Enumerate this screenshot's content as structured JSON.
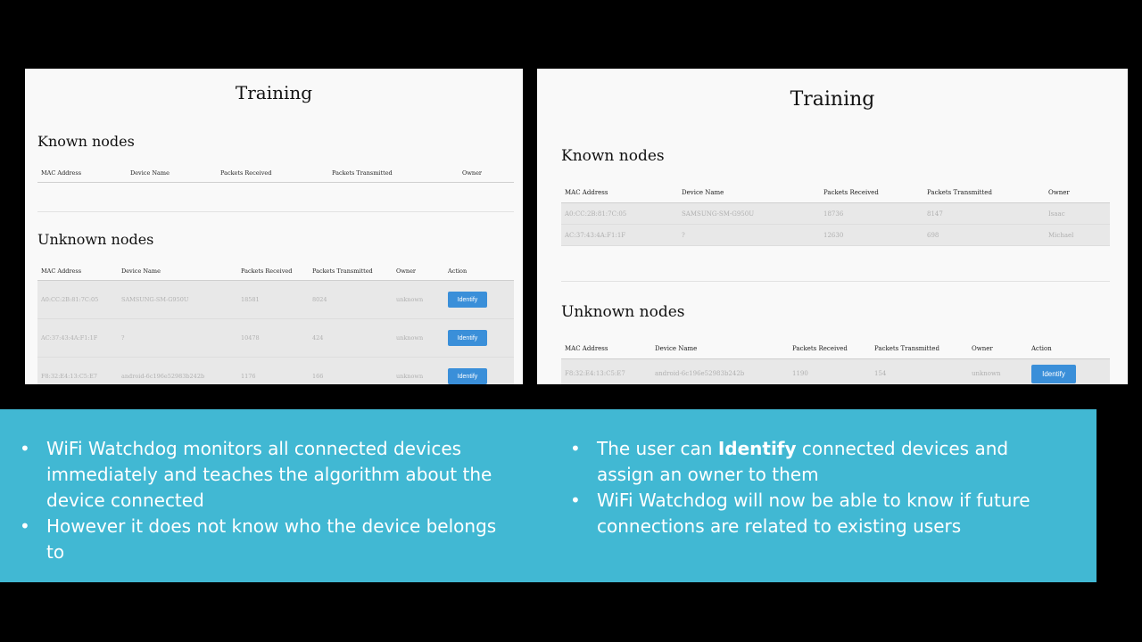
{
  "left_screen": {
    "title": "Training",
    "known": {
      "heading": "Known nodes",
      "columns": [
        "MAC Address",
        "Device Name",
        "Packets Received",
        "Packets Transmitted",
        "Owner"
      ]
    },
    "unknown": {
      "heading": "Unknown nodes",
      "columns": [
        "MAC Address",
        "Device Name",
        "Packets Received",
        "Packets Transmitted",
        "Owner",
        "Action"
      ],
      "rows": [
        {
          "mac": "A0:CC:2B:81:7C:05",
          "device": "SAMSUNG-SM-G950U",
          "received": "18581",
          "transmitted": "8024",
          "owner": "unknown",
          "action": "Identify"
        },
        {
          "mac": "AC:37:43:4A:F1:1F",
          "device": "?",
          "received": "10478",
          "transmitted": "424",
          "owner": "unknown",
          "action": "Identify"
        },
        {
          "mac": "F8:32:E4:13:C5:E7",
          "device": "android-6c196e52983b242b",
          "received": "1176",
          "transmitted": "166",
          "owner": "unknown",
          "action": "Identify"
        }
      ]
    }
  },
  "right_screen": {
    "title": "Training",
    "known": {
      "heading": "Known nodes",
      "columns": [
        "MAC Address",
        "Device Name",
        "Packets Received",
        "Packets Transmitted",
        "Owner"
      ],
      "rows": [
        {
          "mac": "A0:CC:2B:81:7C:05",
          "device": "SAMSUNG-SM-G950U",
          "received": "18736",
          "transmitted": "8147",
          "owner": "Isaac"
        },
        {
          "mac": "AC:37:43:4A:F1:1F",
          "device": "?",
          "received": "12630",
          "transmitted": "698",
          "owner": "Michael"
        }
      ]
    },
    "unknown": {
      "heading": "Unknown nodes",
      "columns": [
        "MAC Address",
        "Device Name",
        "Packets Received",
        "Packets Transmitted",
        "Owner",
        "Action"
      ],
      "rows": [
        {
          "mac": "F8:32:E4:13:C5:E7",
          "device": "android-6c196e52983b242b",
          "received": "1190",
          "transmitted": "154",
          "owner": "unknown",
          "action": "Identify"
        }
      ]
    }
  },
  "banner": {
    "bullet_glyph": "•",
    "left": [
      "WiFi Watchdog monitors all connected devices immediately and teaches the algorithm about the device connected",
      "However it does not know who the device belongs to"
    ],
    "right": [
      {
        "before": "The user can ",
        "bold": "Identify",
        "after": " connected devices and assign an owner to them"
      },
      {
        "before": "WiFi Watchdog will now be able to know if future connections are related to existing users",
        "bold": "",
        "after": ""
      }
    ]
  },
  "colors": {
    "slide_background": "#000000",
    "banner": "#41b8d3",
    "identify_button": "#3a8fd9",
    "screenshot_background": "#f9f9f9"
  }
}
